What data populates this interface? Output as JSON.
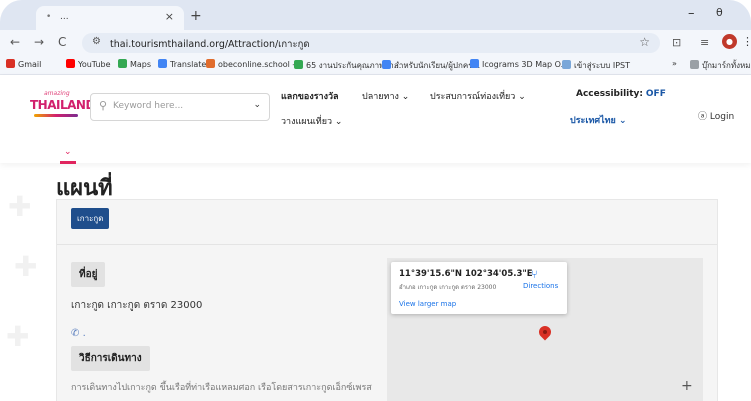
{
  "browser": {
    "tab_title": "...",
    "tab_favicon": "•",
    "new_tab_symbol": "+",
    "close_symbol": "×",
    "win_min_symbol": "–",
    "win_restore_symbol": "θ",
    "url": "thai.tourismthailand.org/Attraction/เกาะกูด",
    "bookmarks": [
      {
        "label": "Gmail",
        "color": "#d93025"
      },
      {
        "label": "YouTube",
        "color": "#ff0000"
      },
      {
        "label": "Maps",
        "color": "#34a853"
      },
      {
        "label": "Translate",
        "color": "#4285f4"
      },
      {
        "label": "obeconline.school -...",
        "color": "#e06c2d"
      },
      {
        "label": "65 งานประกันคุณภาพกา...",
        "color": "#34a853"
      },
      {
        "label": "สำหรับนักเรียน/ผู้ปกคร...",
        "color": "#4285f4"
      },
      {
        "label": "Icograms 3D Map O...",
        "color": "#4285f4"
      },
      {
        "label": "เข้าสู่ระบบ IPST",
        "color": "#7aa7d9"
      },
      {
        "label": "»",
        "color": "#f3f6fb"
      },
      {
        "label": "บุ๊กมาร์กทั้งหมด",
        "color": "#9aa0a6"
      }
    ]
  },
  "header": {
    "logo_small": "amazing",
    "logo_main": "THAILAND",
    "search_placeholder": "Keyword here...",
    "nav": {
      "awards": "แลกของรางวัล",
      "destinations": "ปลายทาง ⌄",
      "experience": "ประสบการณ์ท่องเที่ยว ⌄",
      "plan": "วางแผนเที่ยว ⌄",
      "accessibility_label": "Accessibility:",
      "accessibility_value": "OFF",
      "language": "ประเทศไทย ⌄",
      "login": "Login"
    }
  },
  "page": {
    "title": "แผนที่",
    "tab_label": "เกาะกูด",
    "address_label": "ที่อยู่",
    "address_value": "เกาะกูด เกาะกูด ตราด 23000",
    "phone_value": ".",
    "directions_label": "วิธีการเดินทาง",
    "directions_text": "การเดินทางไปเกาะกูด ขึ้นเรือที่ท่าเรือแหลมศอก เรือโดยสารเกาะกูดเอ็กซ์เพรส"
  },
  "map": {
    "coords": "11°39'15.6\"N 102°34'05.3\"E",
    "address": "อำเภอ เกาะกูด เกาะกูด ตราด 23000",
    "directions": "Directions",
    "larger_map": "View larger map",
    "zoom_in": "+"
  }
}
